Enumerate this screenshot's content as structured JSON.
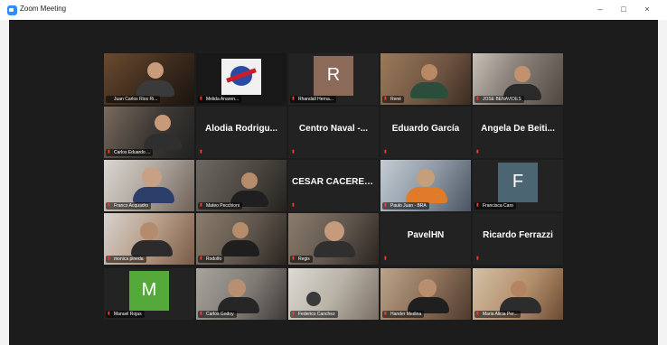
{
  "window": {
    "title": "Zoom Meeting",
    "controls": {
      "minimize": "–",
      "restore": "□",
      "close": "×"
    }
  },
  "colors": {
    "stage_bg": "#1c1c1c",
    "tile_bg": "#222222",
    "active_speaker_border": "#b9d24a",
    "mic_muted": "#ff3b30",
    "avatar_R_bg": "#8c6a5a",
    "avatar_F_bg": "#4b6573",
    "avatar_M_bg": "#55a83a"
  },
  "participants": [
    {
      "label": "Juan Carlos Rios Ri...",
      "type": "video",
      "active": true
    },
    {
      "label": "Melida Anaren...",
      "type": "video"
    },
    {
      "label": "Rhandall Herna...",
      "type": "avatar",
      "initial": "R"
    },
    {
      "label": "René",
      "type": "video"
    },
    {
      "label": "JOSE BENAVIDES",
      "type": "video"
    },
    {
      "label": "Carlos Eduardo ...",
      "type": "video"
    },
    {
      "big_name": "Alodia Rodrigu...",
      "type": "name"
    },
    {
      "big_name": "Centro Naval -...",
      "type": "name"
    },
    {
      "big_name": "Eduardo García",
      "type": "name"
    },
    {
      "big_name": "Angela De Beiti...",
      "type": "name"
    },
    {
      "label": "Franco Acquadro",
      "type": "video"
    },
    {
      "label": "Mateo Pecchioni",
      "type": "video"
    },
    {
      "big_name": "CESAR CACERES...",
      "type": "name"
    },
    {
      "label": "Paulo Juan - BRA",
      "type": "video"
    },
    {
      "label": "Francisca Caro",
      "type": "avatar",
      "initial": "F"
    },
    {
      "label": "monica pineda",
      "type": "video"
    },
    {
      "label": "Rodolfo",
      "type": "video"
    },
    {
      "label": "Regis",
      "type": "video"
    },
    {
      "big_name": "PavelHN",
      "type": "name"
    },
    {
      "big_name": "Ricardo Ferrazzi",
      "type": "name"
    },
    {
      "label": "Manuel Rojas",
      "type": "avatar",
      "initial": "M"
    },
    {
      "label": "Carlos Godoy",
      "type": "video"
    },
    {
      "label": "Federico Canchez",
      "type": "video"
    },
    {
      "label": "Hander Medina",
      "type": "video"
    },
    {
      "label": "Maria Alicia Per...",
      "type": "video"
    }
  ]
}
